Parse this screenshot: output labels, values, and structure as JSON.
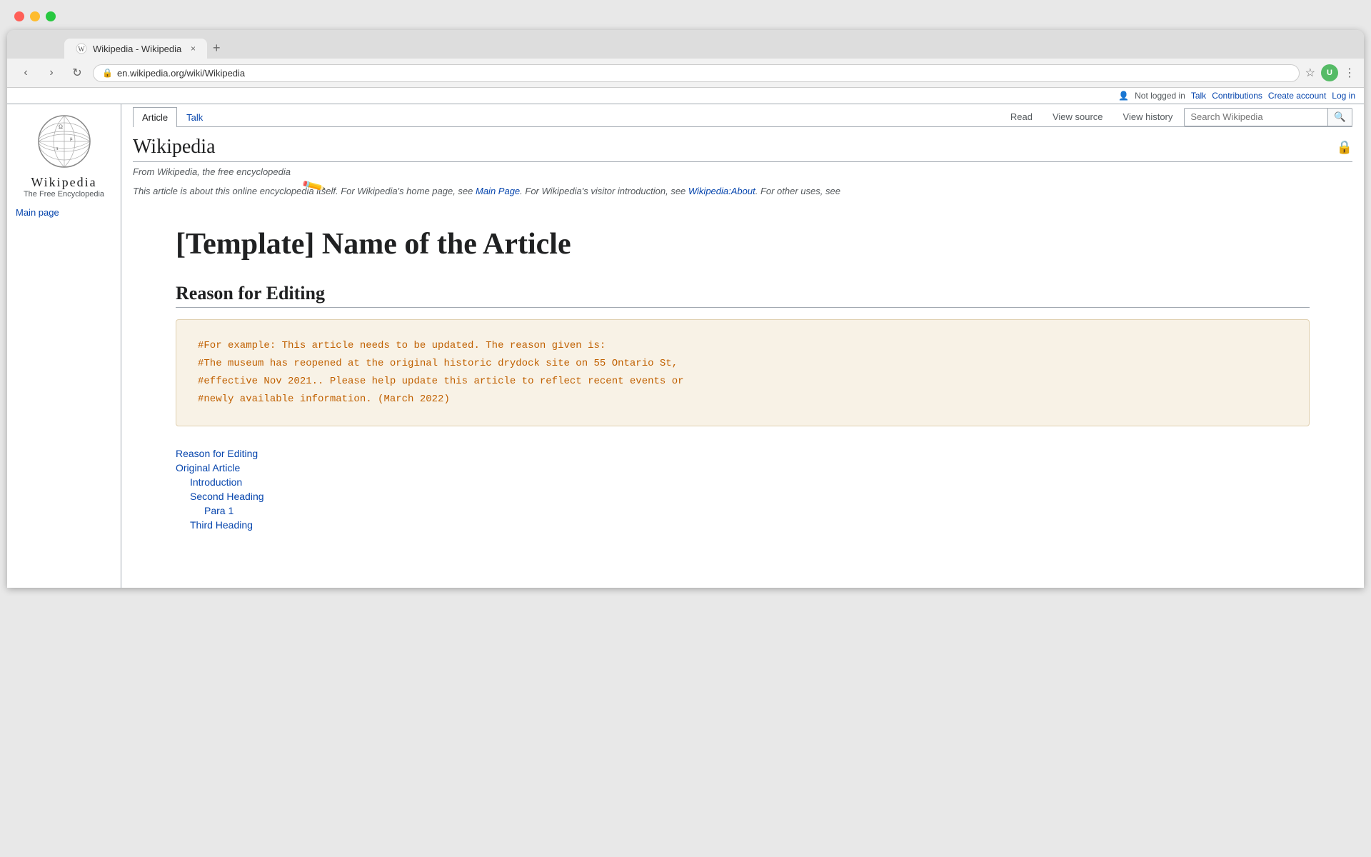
{
  "os": {
    "traffic_lights": [
      "red",
      "yellow",
      "green"
    ]
  },
  "browser": {
    "tab": {
      "favicon": "W",
      "title": "Wikipedia - Wikipedia",
      "close": "×"
    },
    "new_tab_label": "+",
    "url_bar": {
      "lock_icon": "🔒",
      "url": "en.wikipedia.org/wiki/Wikipedia",
      "star_icon": "☆",
      "menu_icon": "⋮"
    },
    "nav": {
      "back": "‹",
      "forward": "›",
      "refresh": "↻"
    }
  },
  "wiki": {
    "top_bar": {
      "not_logged_in": "Not logged in",
      "talk_label": "Talk",
      "contributions_label": "Contributions",
      "create_account_label": "Create account",
      "login_label": "Log in",
      "user_icon": "👤"
    },
    "sidebar": {
      "logo_title": "Wikipedia",
      "logo_subtitle": "The Free Encyclopedia",
      "main_page_label": "Main page"
    },
    "tabs": {
      "article_label": "Article",
      "talk_label": "Talk",
      "read_label": "Read",
      "view_source_label": "View source",
      "view_history_label": "View history",
      "search_placeholder": "Search Wikipedia"
    },
    "article": {
      "title": "Wikipedia",
      "subtitle": "From Wikipedia, the free encyclopedia",
      "hatnote": "This article is about this online encyclopedia itself. For Wikipedia's home page, see Main Page. For Wikipedia's visitor introduction, see Wikipedia:About. For other uses, see",
      "hatnote_main_page_link": "Main Page",
      "hatnote_about_link": "Wikipedia:About",
      "lock_icon": "🔒"
    },
    "template": {
      "main_title": "[Template] Name of the Article",
      "section_heading": "Reason for Editing",
      "update_box_lines": [
        "#For example: This article needs to be updated. The reason given is:",
        "#The museum has reopened at the original historic drydock site on 55 Ontario St,",
        "#effective Nov 2021.. Please help update this article to reflect recent events or",
        "#newly available information. (March 2022)"
      ],
      "toc": [
        {
          "label": "Reason for Editing",
          "indent": 0
        },
        {
          "label": "Original Article",
          "indent": 0
        },
        {
          "label": "Introduction",
          "indent": 1
        },
        {
          "label": "Second Heading",
          "indent": 1
        },
        {
          "label": "Para 1",
          "indent": 2
        },
        {
          "label": "Third Heading",
          "indent": 1
        }
      ]
    }
  }
}
